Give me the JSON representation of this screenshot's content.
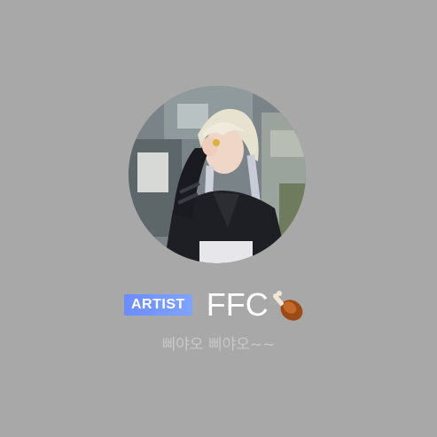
{
  "profile": {
    "badge": "ARTIST",
    "name": "FFC",
    "name_emoji_icon": "drumstick-icon",
    "bio": "삐야오 삐야오~~",
    "colors": {
      "background": "#a8a8a8",
      "badge_gradient_start": "#6c8cff",
      "badge_gradient_end": "#7fa3ff",
      "name_text": "#ffffff",
      "bio_text": "#c9c9c9"
    }
  }
}
